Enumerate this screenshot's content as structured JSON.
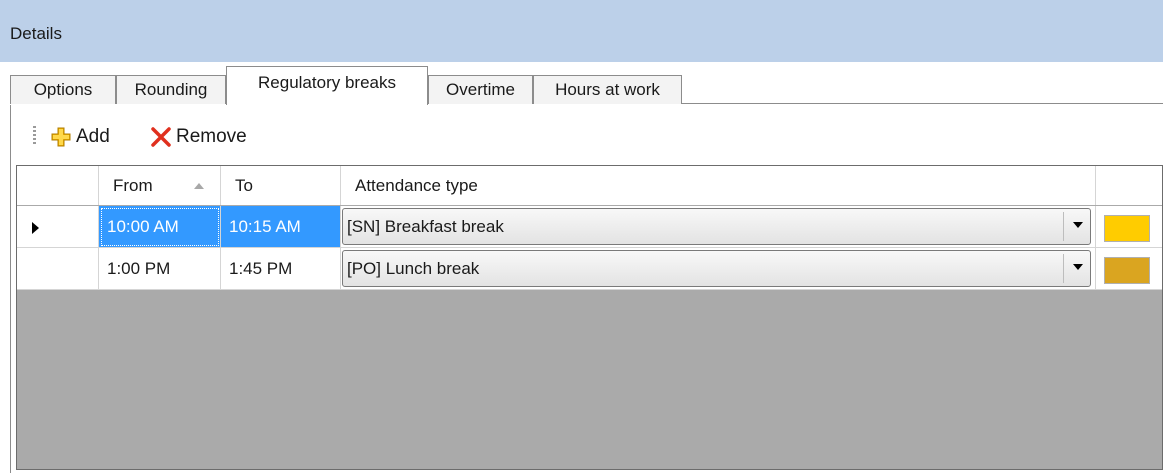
{
  "panel": {
    "title": "Details"
  },
  "tabs": [
    {
      "label": "Options",
      "active": false
    },
    {
      "label": "Rounding",
      "active": false
    },
    {
      "label": "Regulatory breaks",
      "active": true
    },
    {
      "label": "Overtime",
      "active": false
    },
    {
      "label": "Hours at work",
      "active": false
    }
  ],
  "toolbar": {
    "add_label": "Add",
    "remove_label": "Remove",
    "add_icon": "plus-icon",
    "remove_icon": "red-x-icon"
  },
  "grid": {
    "columns": {
      "from": "From",
      "to": "To",
      "attendance_type": "Attendance type"
    },
    "sort": {
      "column": "From",
      "direction": "ascending"
    },
    "rows": [
      {
        "from": "10:00 AM",
        "to": "10:15 AM",
        "attendance_type": "[SN]  Breakfast break",
        "color": "#ffcc00",
        "current": true,
        "selected": true
      },
      {
        "from": "1:00 PM",
        "to": "1:45 PM",
        "attendance_type": "[PO]  Lunch break",
        "color": "#daa520",
        "current": false,
        "selected": false
      }
    ]
  },
  "colors": {
    "header_bg": "#bcd0e9",
    "selection": "#3399ff",
    "grid_empty": "#aaaaaa",
    "remove_icon": "#e0301e",
    "add_icon": "#f2b400"
  }
}
